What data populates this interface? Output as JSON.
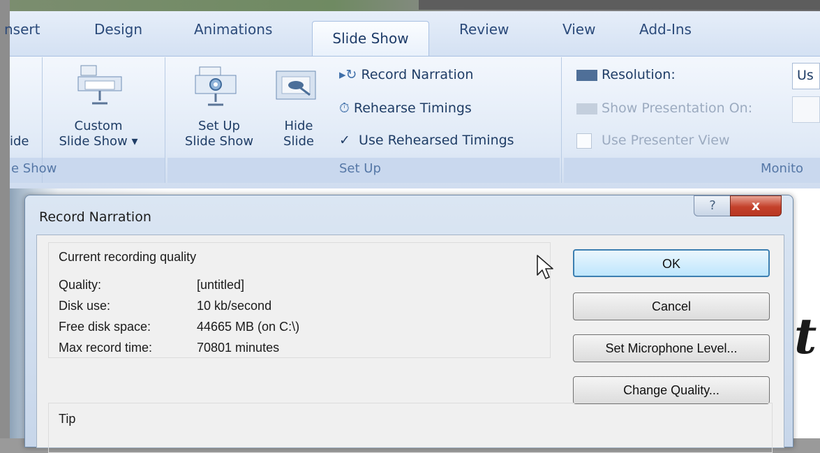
{
  "ribbon": {
    "tabs": [
      "nsert",
      "Design",
      "Animations",
      "Slide Show",
      "Review",
      "View",
      "Add-Ins"
    ],
    "active_tab": "Slide Show",
    "left_cut_label": "ide",
    "left_group_label": "e Show",
    "custom_show": {
      "line1": "Custom",
      "line2": "Slide Show ▾"
    },
    "setup_show": {
      "line1": "Set Up",
      "line2": "Slide Show"
    },
    "hide_slide": {
      "line1": "Hide",
      "line2": "Slide"
    },
    "record_narration": "Record Narration",
    "rehearse_timings": "Rehearse Timings",
    "use_rehearsed_timings": "Use Rehearsed Timings",
    "use_rehearsed_checked": true,
    "setup_group_label": "Set Up",
    "resolution_label": "Resolution:",
    "resolution_value": "Us",
    "show_on_label": "Show Presentation On:",
    "presenter_view_label": "Use Presenter View",
    "monitors_group_label": "Monito"
  },
  "dialog": {
    "title": "Record Narration",
    "help_glyph": "?",
    "close_glyph": "x",
    "quality_heading": "Current recording quality",
    "rows": [
      {
        "label": "Quality:",
        "value": "[untitled]"
      },
      {
        "label": "Disk use:",
        "value": "10 kb/second"
      },
      {
        "label": "Free disk space:",
        "value": "44665 MB (on C:\\)"
      },
      {
        "label": "Max record time:",
        "value": "70801 minutes"
      }
    ],
    "buttons": {
      "ok": "OK",
      "cancel": "Cancel",
      "mic_level": "Set Microphone Level...",
      "change_quality": "Change Quality..."
    },
    "tip_label": "Tip"
  },
  "slide": {
    "visible_letter": "t"
  },
  "colors": {
    "ribbon_text": "#1f3d66",
    "close_red": "#c4412b",
    "default_button_border": "#3c7fb1"
  }
}
